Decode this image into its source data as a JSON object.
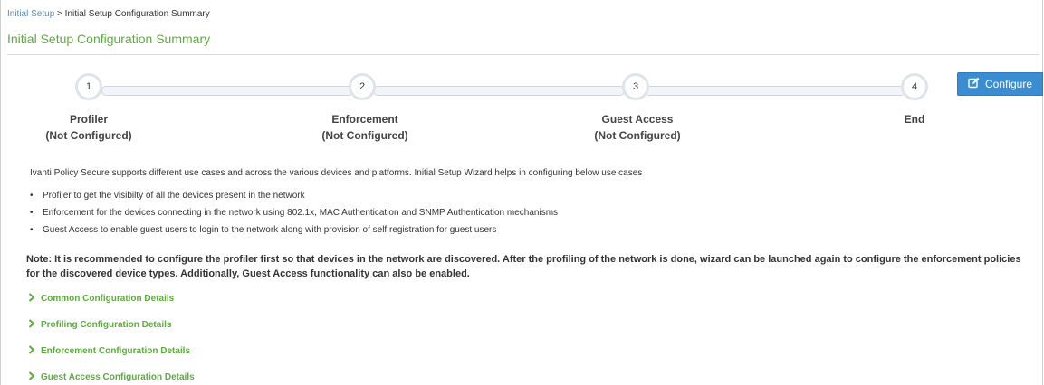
{
  "breadcrumb": {
    "link": "Initial Setup",
    "separator": ">",
    "current": "Initial Setup Configuration Summary"
  },
  "page_title": "Initial Setup Configuration Summary",
  "steps": [
    {
      "number": "1",
      "name": "Profiler",
      "status": "(Not Configured)"
    },
    {
      "number": "2",
      "name": "Enforcement",
      "status": "(Not Configured)"
    },
    {
      "number": "3",
      "name": "Guest Access",
      "status": "(Not Configured)"
    },
    {
      "number": "4",
      "name": "End",
      "status": ""
    }
  ],
  "configure_button": {
    "label": "Configure",
    "icon": "edit-icon"
  },
  "intro_text": "Ivanti Policy Secure supports different use cases and across the various devices and platforms. Initial Setup Wizard helps in configuring below use cases",
  "use_cases": [
    "Profiler to get the visibilty of all the devices present in the network",
    "Enforcement for the devices connecting in the network using 802.1x, MAC Authentication and SNMP Authentication mechanisms",
    "Guest Access to enable guest users to login to the network along with provision of self registration for guest users"
  ],
  "note": "Note: It is recommended to configure the profiler first so that devices in the network are discovered. After the profiling of the network is done, wizard can be launched again to configure the enforcement policies for the discovered device types. Additionally, Guest Access functionality can also be enabled.",
  "sections": [
    {
      "label": "Common Configuration Details"
    },
    {
      "label": "Profiling Configuration Details"
    },
    {
      "label": "Enforcement Configuration Details"
    },
    {
      "label": "Guest Access Configuration Details"
    }
  ],
  "colors": {
    "accent_green": "#5cad3c",
    "link_blue": "#4a90c8",
    "button_blue": "#3a8dd1"
  }
}
